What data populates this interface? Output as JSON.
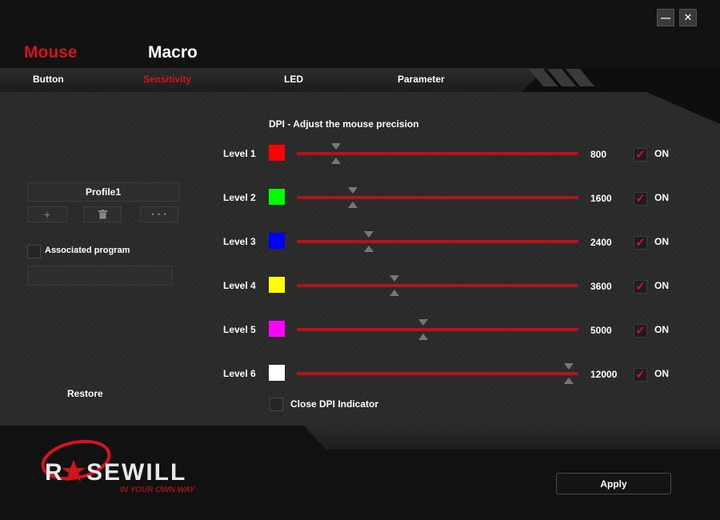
{
  "window": {
    "minimize_glyph": "—",
    "close_glyph": "✕"
  },
  "main_tabs": [
    {
      "label": "Mouse",
      "active": true
    },
    {
      "label": "Macro",
      "active": false
    }
  ],
  "sub_tabs": [
    {
      "label": "Button",
      "active": false
    },
    {
      "label": "Sensitivity",
      "active": true
    },
    {
      "label": "LED",
      "active": false
    },
    {
      "label": "Parameter",
      "active": false
    }
  ],
  "left_panel": {
    "profile_name": "Profile1",
    "add_glyph": "+",
    "delete_icon": "trash-icon",
    "more_glyph": "• • •",
    "associated_program_label": "Associated program",
    "associated_program_checked": false,
    "associated_program_value": "",
    "restore_label": "Restore"
  },
  "dpi": {
    "heading": "DPI  -  Adjust the mouse precision",
    "slider_max": 12000,
    "levels": [
      {
        "label": "Level 1",
        "color": "#ff0000",
        "value": "800",
        "enabled": true,
        "on_label": "ON"
      },
      {
        "label": "Level 2",
        "color": "#00ff00",
        "value": "1600",
        "enabled": true,
        "on_label": "ON"
      },
      {
        "label": "Level 3",
        "color": "#0000ff",
        "value": "2400",
        "enabled": true,
        "on_label": "ON"
      },
      {
        "label": "Level 4",
        "color": "#ffff00",
        "value": "3600",
        "enabled": true,
        "on_label": "ON"
      },
      {
        "label": "Level 5",
        "color": "#ff00ff",
        "value": "5000",
        "enabled": true,
        "on_label": "ON"
      },
      {
        "label": "Level 6",
        "color": "#ffffff",
        "value": "12000",
        "enabled": true,
        "on_label": "ON"
      }
    ],
    "close_indicator_label": "Close DPI Indicator",
    "close_indicator_checked": false
  },
  "footer": {
    "brand": "RSEWILL",
    "tagline": "IN YOUR OWN WAY",
    "apply_label": "Apply"
  },
  "colors": {
    "accent": "#d4141c",
    "track": "#b3141a",
    "background": "#2a2a2a"
  }
}
